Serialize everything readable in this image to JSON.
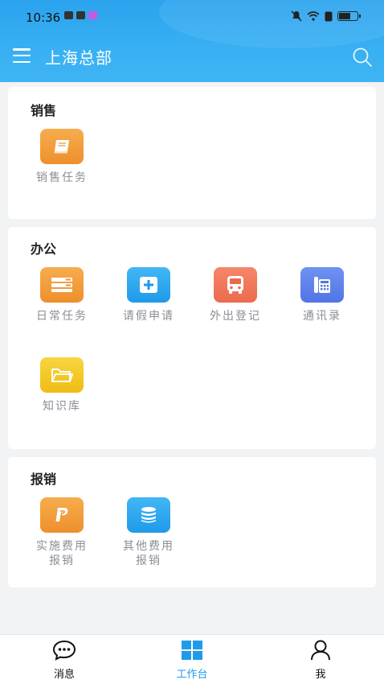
{
  "status_bar": {
    "time": "10:36"
  },
  "header": {
    "title": "上海总部"
  },
  "sections": [
    {
      "title": "销售",
      "items": [
        {
          "label": "销售任务",
          "icon": "book-icon",
          "color": "#f09a33"
        }
      ]
    },
    {
      "title": "办公",
      "items": [
        {
          "label": "日常任务",
          "icon": "list-icon",
          "color": "#f09a33"
        },
        {
          "label": "请假申请",
          "icon": "plus-box-icon",
          "color": "#2ba4ee"
        },
        {
          "label": "外出登记",
          "icon": "bus-icon",
          "color": "#ee7556"
        },
        {
          "label": "通讯录",
          "icon": "phone-book-icon",
          "color": "#5b7ee9"
        },
        {
          "label": "知识库",
          "icon": "folder-icon",
          "color": "#f3c522"
        }
      ]
    },
    {
      "title": "报销",
      "items": [
        {
          "label_line1": "实施费用",
          "label_line2": "报销",
          "icon": "paypal-icon",
          "color": "#f09a33"
        },
        {
          "label_line1": "其他费用",
          "label_line2": "报销",
          "icon": "coins-icon",
          "color": "#2ba4ee"
        }
      ]
    }
  ],
  "bottom_nav": {
    "messages": "消息",
    "workbench": "工作台",
    "me": "我",
    "active_color": "#1e9be9"
  }
}
